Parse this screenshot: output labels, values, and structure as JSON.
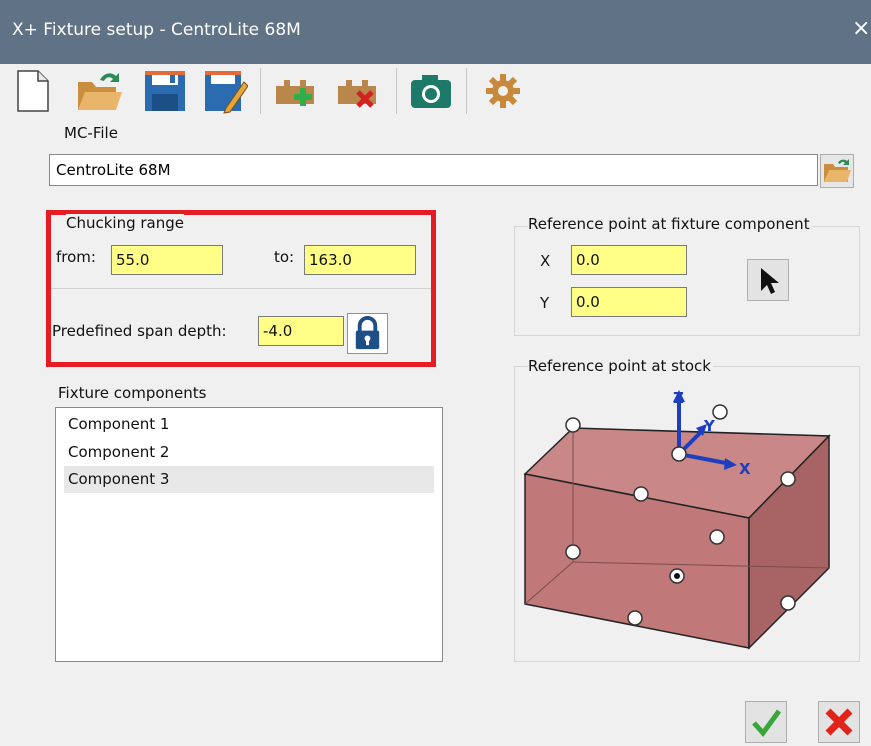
{
  "window": {
    "title": "X+ Fixture setup - CentroLite 68M",
    "close_icon": "×"
  },
  "toolbar": {
    "icons": [
      "new-file-icon",
      "open-folder-icon",
      "save-icon",
      "save-as-icon",
      "add-component-icon",
      "delete-component-icon",
      "camera-icon",
      "settings-icon"
    ]
  },
  "mc_file": {
    "label": "MC-File",
    "value": "CentroLite 68M"
  },
  "chucking": {
    "group_label": "Chucking range",
    "from_label": "from:",
    "from_value": "55.0",
    "to_label": "to:",
    "to_value": "163.0",
    "span_label": "Predefined span depth:",
    "span_value": "-4.0"
  },
  "ref_fixture": {
    "group_label": "Reference point at fixture component",
    "x_label": "X",
    "x_value": "0.0",
    "y_label": "Y",
    "y_value": "0.0"
  },
  "components": {
    "group_label": "Fixture components",
    "items": [
      "Component 1",
      "Component 2",
      "Component 3"
    ],
    "selected_index": 2
  },
  "ref_stock": {
    "group_label": "Reference point at stock",
    "axis_x": "X",
    "axis_y": "Y",
    "axis_z": "Z"
  },
  "colors": {
    "titlebar": "#5f7286",
    "highlight_box": "#e51c24",
    "field_bg": "#ffff88",
    "cube_fill": "#c98787"
  }
}
